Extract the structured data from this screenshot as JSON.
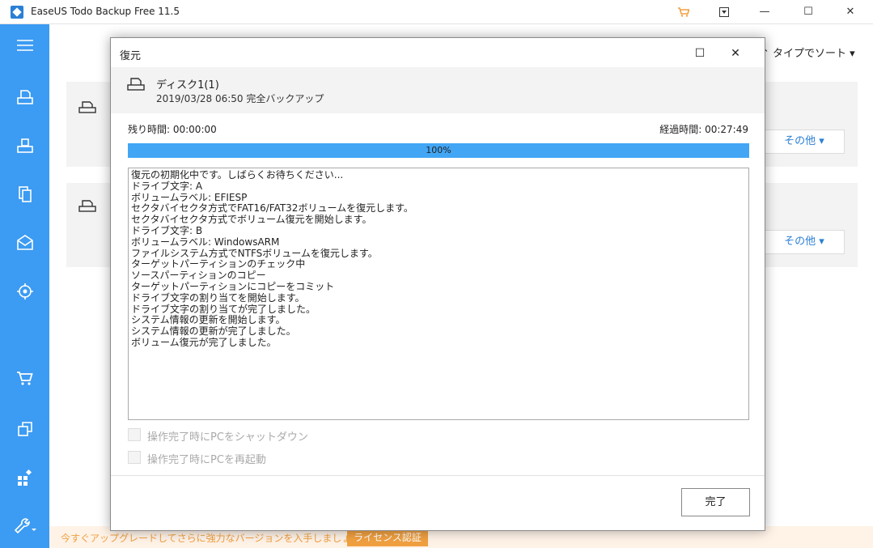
{
  "app": {
    "title": "EaseUS Todo Backup Free 11.5"
  },
  "titlebar": {
    "minimize": "—",
    "maximize": "☐",
    "close": "✕"
  },
  "background": {
    "sort_label": "↑ タイプでソート ▾",
    "other_button_1": "その他 ▾",
    "other_button_2": "その他 ▾",
    "upgrade_text": "今すぐアップグレードしてさらに強力なバージョンを入手しましょう。",
    "license_button": "ライセンス認証"
  },
  "dialog": {
    "title": "復元",
    "maximize": "☐",
    "close": "✕",
    "disk_name": "ディスク1(1)",
    "disk_sub": "2019/03/28 06:50 完全バックアップ",
    "remaining_label": "残り時間: 00:00:00",
    "elapsed_label": "経過時間: 00:27:49",
    "progress": {
      "value": 1.0,
      "text": "100%"
    },
    "log": [
      "復元の初期化中です。しばらくお待ちください...",
      "ドライブ文字: A",
      "ボリュームラベル: EFIESP",
      "セクタバイセクタ方式でFAT16/FAT32ボリュームを復元します。",
      "セクタバイセクタ方式でボリューム復元を開始します。",
      "ドライブ文字: B",
      "ボリュームラベル: WindowsARM",
      "ファイルシステム方式でNTFSボリュームを復元します。",
      "ターゲットパーティションのチェック中",
      "ソースパーティションのコピー",
      "ターゲットパーティションにコピーをコミット",
      "ドライブ文字の割り当てを開始します。",
      "ドライブ文字の割り当てが完了しました。",
      "システム情報の更新を開始します。",
      "システム情報の更新が完了しました。",
      "ボリューム復元が完了しました。"
    ],
    "shutdown_label": "操作完了時にPCをシャットダウン",
    "restart_label": "操作完了時にPCを再起動",
    "done_button": "完了"
  },
  "colors": {
    "accent": "#3c9bf2",
    "progress": "#42a6f5",
    "upgrade": "#f0a040"
  },
  "icons": [
    "app-logo-icon",
    "cart-icon",
    "dropdown-icon",
    "menu-icon",
    "disk-backup-icon",
    "system-backup-icon",
    "file-backup-icon",
    "mail-backup-icon",
    "smart-backup-icon",
    "shop-icon",
    "clone-icon",
    "apps-icon",
    "tools-icon",
    "disk-icon"
  ]
}
